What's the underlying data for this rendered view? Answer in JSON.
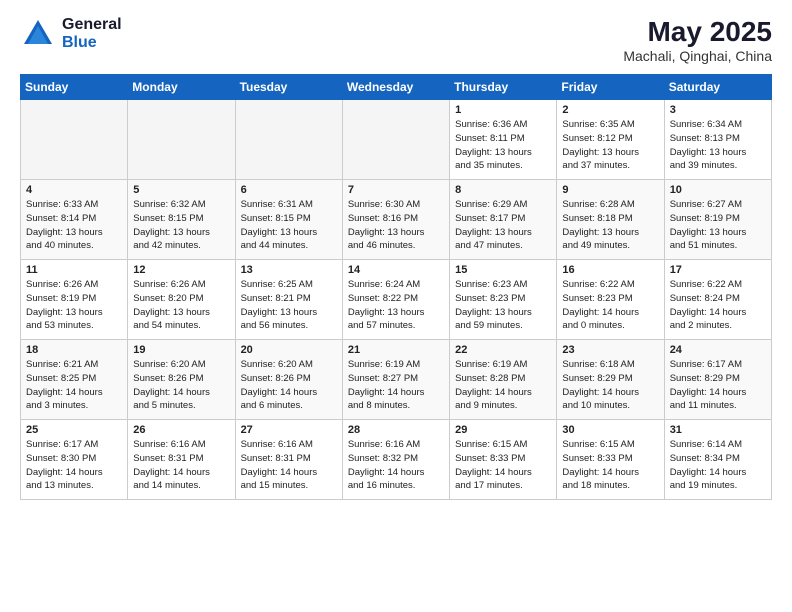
{
  "header": {
    "logo_general": "General",
    "logo_blue": "Blue",
    "month_title": "May 2025",
    "location": "Machali, Qinghai, China"
  },
  "days_of_week": [
    "Sunday",
    "Monday",
    "Tuesday",
    "Wednesday",
    "Thursday",
    "Friday",
    "Saturday"
  ],
  "weeks": [
    [
      {
        "day": "",
        "info": ""
      },
      {
        "day": "",
        "info": ""
      },
      {
        "day": "",
        "info": ""
      },
      {
        "day": "",
        "info": ""
      },
      {
        "day": "1",
        "info": "Sunrise: 6:36 AM\nSunset: 8:11 PM\nDaylight: 13 hours\nand 35 minutes."
      },
      {
        "day": "2",
        "info": "Sunrise: 6:35 AM\nSunset: 8:12 PM\nDaylight: 13 hours\nand 37 minutes."
      },
      {
        "day": "3",
        "info": "Sunrise: 6:34 AM\nSunset: 8:13 PM\nDaylight: 13 hours\nand 39 minutes."
      }
    ],
    [
      {
        "day": "4",
        "info": "Sunrise: 6:33 AM\nSunset: 8:14 PM\nDaylight: 13 hours\nand 40 minutes."
      },
      {
        "day": "5",
        "info": "Sunrise: 6:32 AM\nSunset: 8:15 PM\nDaylight: 13 hours\nand 42 minutes."
      },
      {
        "day": "6",
        "info": "Sunrise: 6:31 AM\nSunset: 8:15 PM\nDaylight: 13 hours\nand 44 minutes."
      },
      {
        "day": "7",
        "info": "Sunrise: 6:30 AM\nSunset: 8:16 PM\nDaylight: 13 hours\nand 46 minutes."
      },
      {
        "day": "8",
        "info": "Sunrise: 6:29 AM\nSunset: 8:17 PM\nDaylight: 13 hours\nand 47 minutes."
      },
      {
        "day": "9",
        "info": "Sunrise: 6:28 AM\nSunset: 8:18 PM\nDaylight: 13 hours\nand 49 minutes."
      },
      {
        "day": "10",
        "info": "Sunrise: 6:27 AM\nSunset: 8:19 PM\nDaylight: 13 hours\nand 51 minutes."
      }
    ],
    [
      {
        "day": "11",
        "info": "Sunrise: 6:26 AM\nSunset: 8:19 PM\nDaylight: 13 hours\nand 53 minutes."
      },
      {
        "day": "12",
        "info": "Sunrise: 6:26 AM\nSunset: 8:20 PM\nDaylight: 13 hours\nand 54 minutes."
      },
      {
        "day": "13",
        "info": "Sunrise: 6:25 AM\nSunset: 8:21 PM\nDaylight: 13 hours\nand 56 minutes."
      },
      {
        "day": "14",
        "info": "Sunrise: 6:24 AM\nSunset: 8:22 PM\nDaylight: 13 hours\nand 57 minutes."
      },
      {
        "day": "15",
        "info": "Sunrise: 6:23 AM\nSunset: 8:23 PM\nDaylight: 13 hours\nand 59 minutes."
      },
      {
        "day": "16",
        "info": "Sunrise: 6:22 AM\nSunset: 8:23 PM\nDaylight: 14 hours\nand 0 minutes."
      },
      {
        "day": "17",
        "info": "Sunrise: 6:22 AM\nSunset: 8:24 PM\nDaylight: 14 hours\nand 2 minutes."
      }
    ],
    [
      {
        "day": "18",
        "info": "Sunrise: 6:21 AM\nSunset: 8:25 PM\nDaylight: 14 hours\nand 3 minutes."
      },
      {
        "day": "19",
        "info": "Sunrise: 6:20 AM\nSunset: 8:26 PM\nDaylight: 14 hours\nand 5 minutes."
      },
      {
        "day": "20",
        "info": "Sunrise: 6:20 AM\nSunset: 8:26 PM\nDaylight: 14 hours\nand 6 minutes."
      },
      {
        "day": "21",
        "info": "Sunrise: 6:19 AM\nSunset: 8:27 PM\nDaylight: 14 hours\nand 8 minutes."
      },
      {
        "day": "22",
        "info": "Sunrise: 6:19 AM\nSunset: 8:28 PM\nDaylight: 14 hours\nand 9 minutes."
      },
      {
        "day": "23",
        "info": "Sunrise: 6:18 AM\nSunset: 8:29 PM\nDaylight: 14 hours\nand 10 minutes."
      },
      {
        "day": "24",
        "info": "Sunrise: 6:17 AM\nSunset: 8:29 PM\nDaylight: 14 hours\nand 11 minutes."
      }
    ],
    [
      {
        "day": "25",
        "info": "Sunrise: 6:17 AM\nSunset: 8:30 PM\nDaylight: 14 hours\nand 13 minutes."
      },
      {
        "day": "26",
        "info": "Sunrise: 6:16 AM\nSunset: 8:31 PM\nDaylight: 14 hours\nand 14 minutes."
      },
      {
        "day": "27",
        "info": "Sunrise: 6:16 AM\nSunset: 8:31 PM\nDaylight: 14 hours\nand 15 minutes."
      },
      {
        "day": "28",
        "info": "Sunrise: 6:16 AM\nSunset: 8:32 PM\nDaylight: 14 hours\nand 16 minutes."
      },
      {
        "day": "29",
        "info": "Sunrise: 6:15 AM\nSunset: 8:33 PM\nDaylight: 14 hours\nand 17 minutes."
      },
      {
        "day": "30",
        "info": "Sunrise: 6:15 AM\nSunset: 8:33 PM\nDaylight: 14 hours\nand 18 minutes."
      },
      {
        "day": "31",
        "info": "Sunrise: 6:14 AM\nSunset: 8:34 PM\nDaylight: 14 hours\nand 19 minutes."
      }
    ]
  ]
}
